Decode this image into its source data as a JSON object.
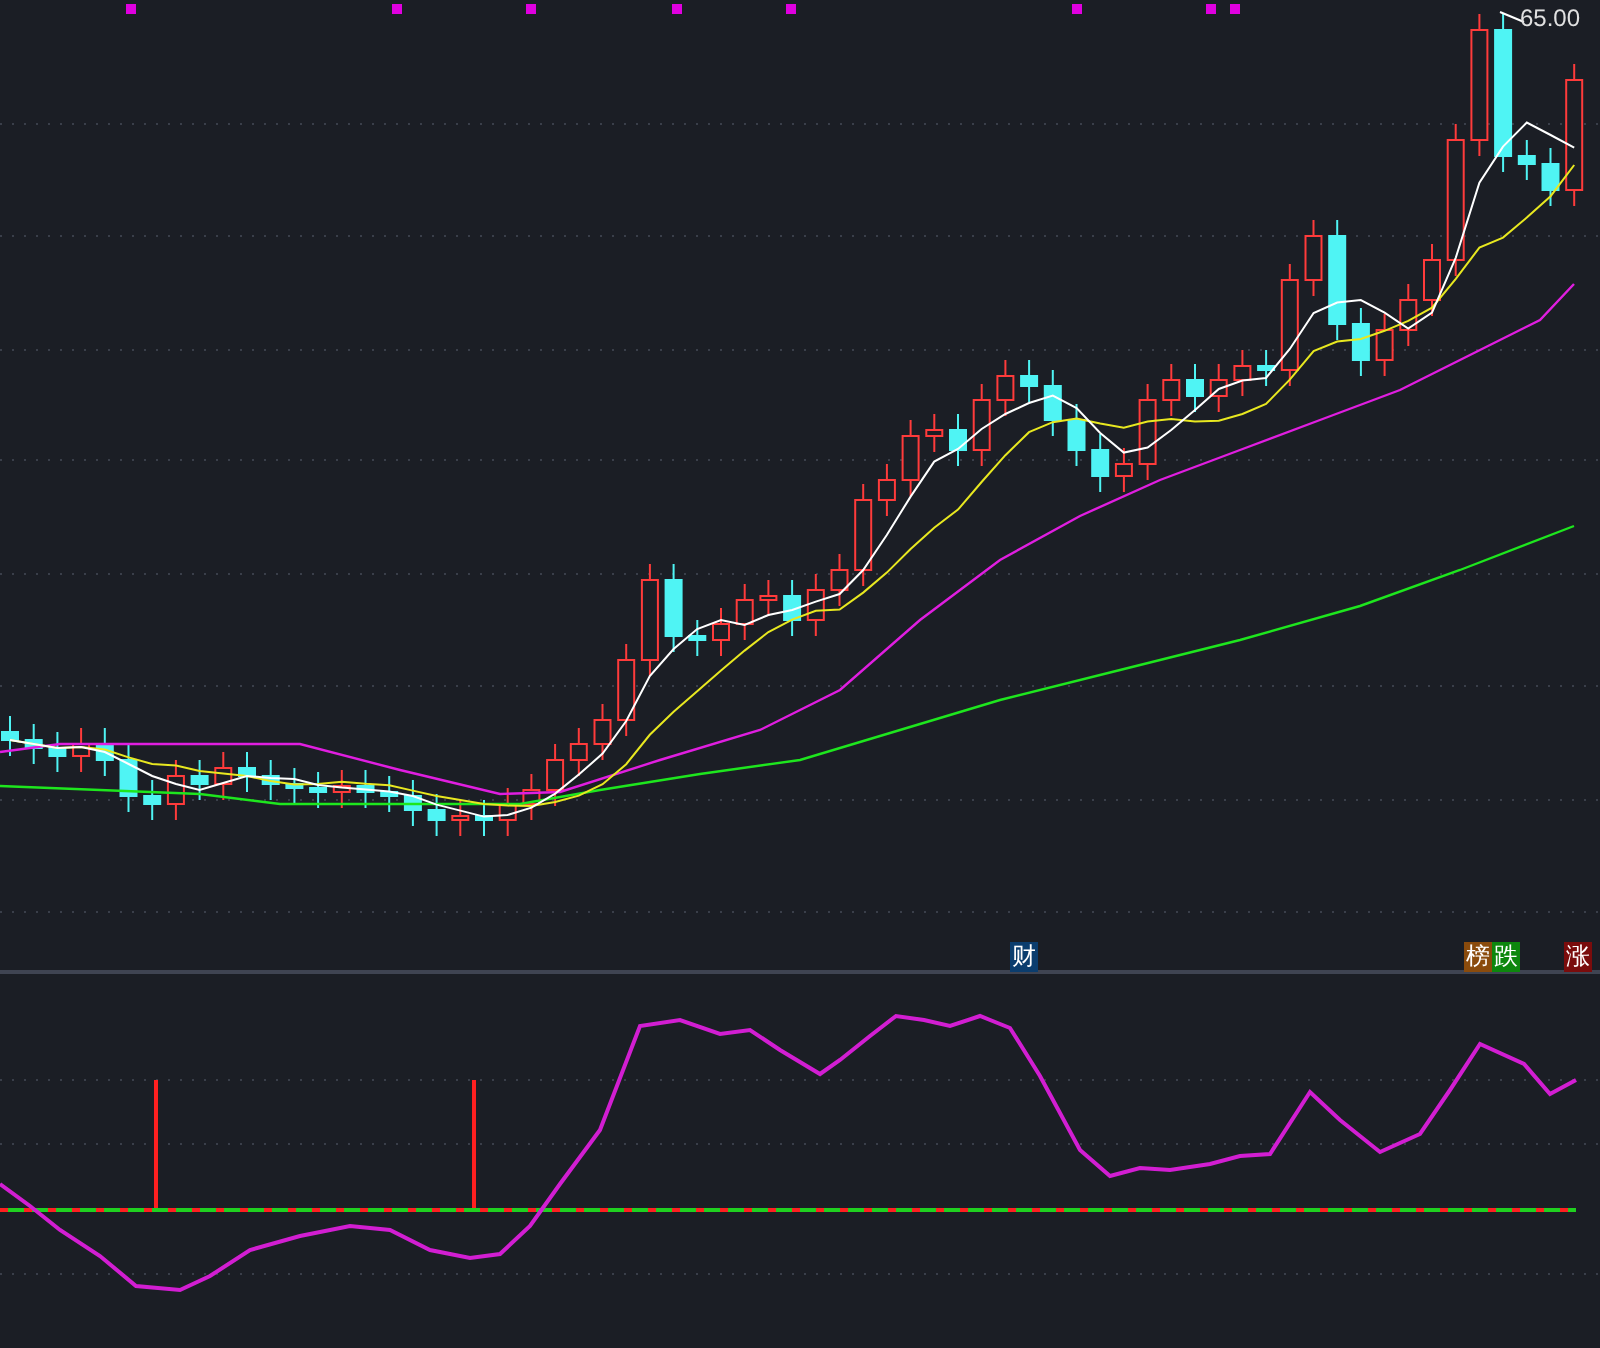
{
  "price_label": "65.00",
  "markers": [
    {
      "label": "财",
      "color": "#0b3d6e"
    },
    {
      "label": "榜",
      "color": "#8a4b0c"
    },
    {
      "label": "跌",
      "color": "#0d870d"
    },
    {
      "label": "涨",
      "color": "#7a0c0c"
    }
  ]
}
